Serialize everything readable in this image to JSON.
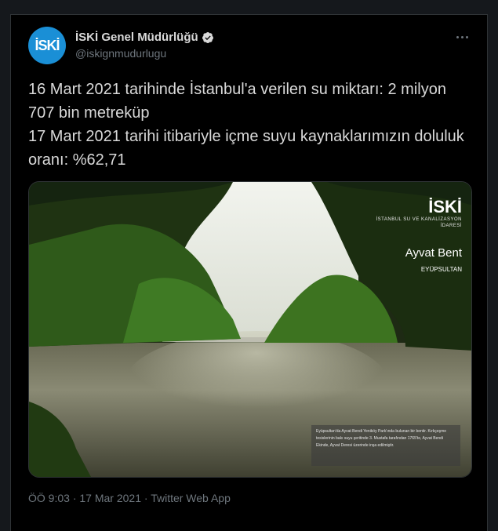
{
  "author": {
    "display_name": "İSKİ Genel Müdürlüğü",
    "handle": "@iskignmudurlugu",
    "avatar_mark": "İSKİ",
    "avatar_text": "İSKİ",
    "verified": true
  },
  "tweet": {
    "text": "16 Mart 2021 tarihinde İstanbul'a verilen su miktarı: 2 milyon 707 bin metreküp\n17 Mart 2021 tarihi itibariyle içme suyu kaynaklarımızın doluluk oranı: %62,71"
  },
  "media": {
    "watermark_logo": "İSKİ",
    "watermark_subtitle": "İSTANBUL SU VE KANALİZASYON İDARESİ",
    "place_name": "Ayvat Bent",
    "district": "EYÜPSULTAN",
    "caption": "Eyüpsultan'da Ayvat Bendi Yeniköy Park'ında bulunan bir bentir. Kırkçeşme tesislerinin bakı suyu şeritinde 3. Mustafa tarafından 1765'te, Ayvat Bendi Ekinde, Ayvat Deresi üzerinde inşa edilmiştir."
  },
  "meta": {
    "time": "ÖÖ 9:03",
    "separator": "·",
    "date": "17 Mar 2021",
    "source": "Twitter Web App"
  },
  "colors": {
    "background": "#15181c",
    "card": "#000000",
    "text": "#d9d9d9",
    "muted": "#6e767d",
    "brand_blue": "#1a8fd6"
  }
}
